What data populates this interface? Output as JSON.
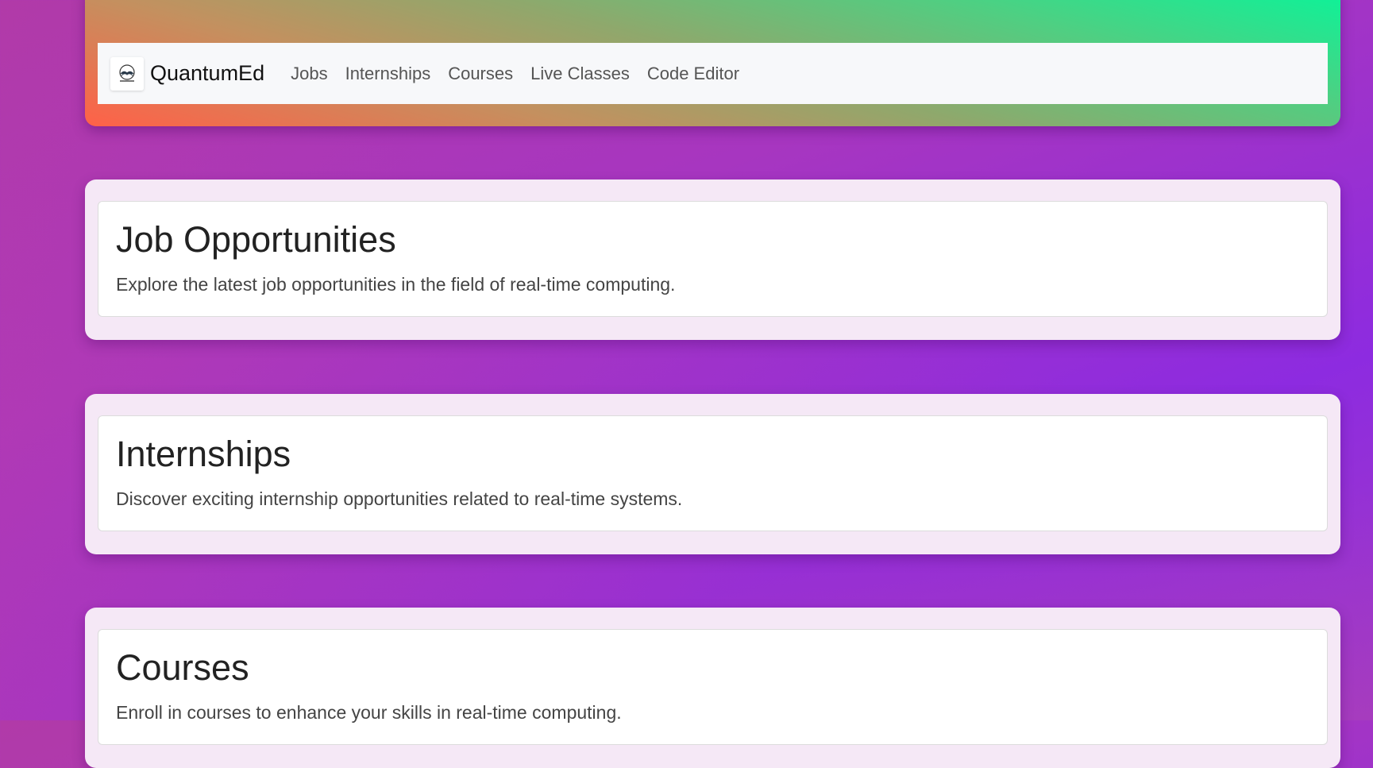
{
  "brand": {
    "name": "QuantumEd",
    "logo_icon": "book-logo-icon"
  },
  "nav": {
    "items": [
      {
        "label": "Jobs"
      },
      {
        "label": "Internships"
      },
      {
        "label": "Courses"
      },
      {
        "label": "Live Classes"
      },
      {
        "label": "Code Editor"
      }
    ]
  },
  "sections": [
    {
      "title": "Job Opportunities",
      "description": "Explore the latest job opportunities in the field of real-time computing."
    },
    {
      "title": "Internships",
      "description": "Discover exciting internship opportunities related to real-time systems."
    },
    {
      "title": "Courses",
      "description": "Enroll in courses to enhance your skills in real-time computing."
    }
  ],
  "colors": {
    "header_gradient_start": "#ff6148",
    "header_gradient_end": "#08f59a",
    "page_background": "#a736c0",
    "section_background": "#f5e8f6",
    "navbar_background": "#f7f8fa"
  }
}
